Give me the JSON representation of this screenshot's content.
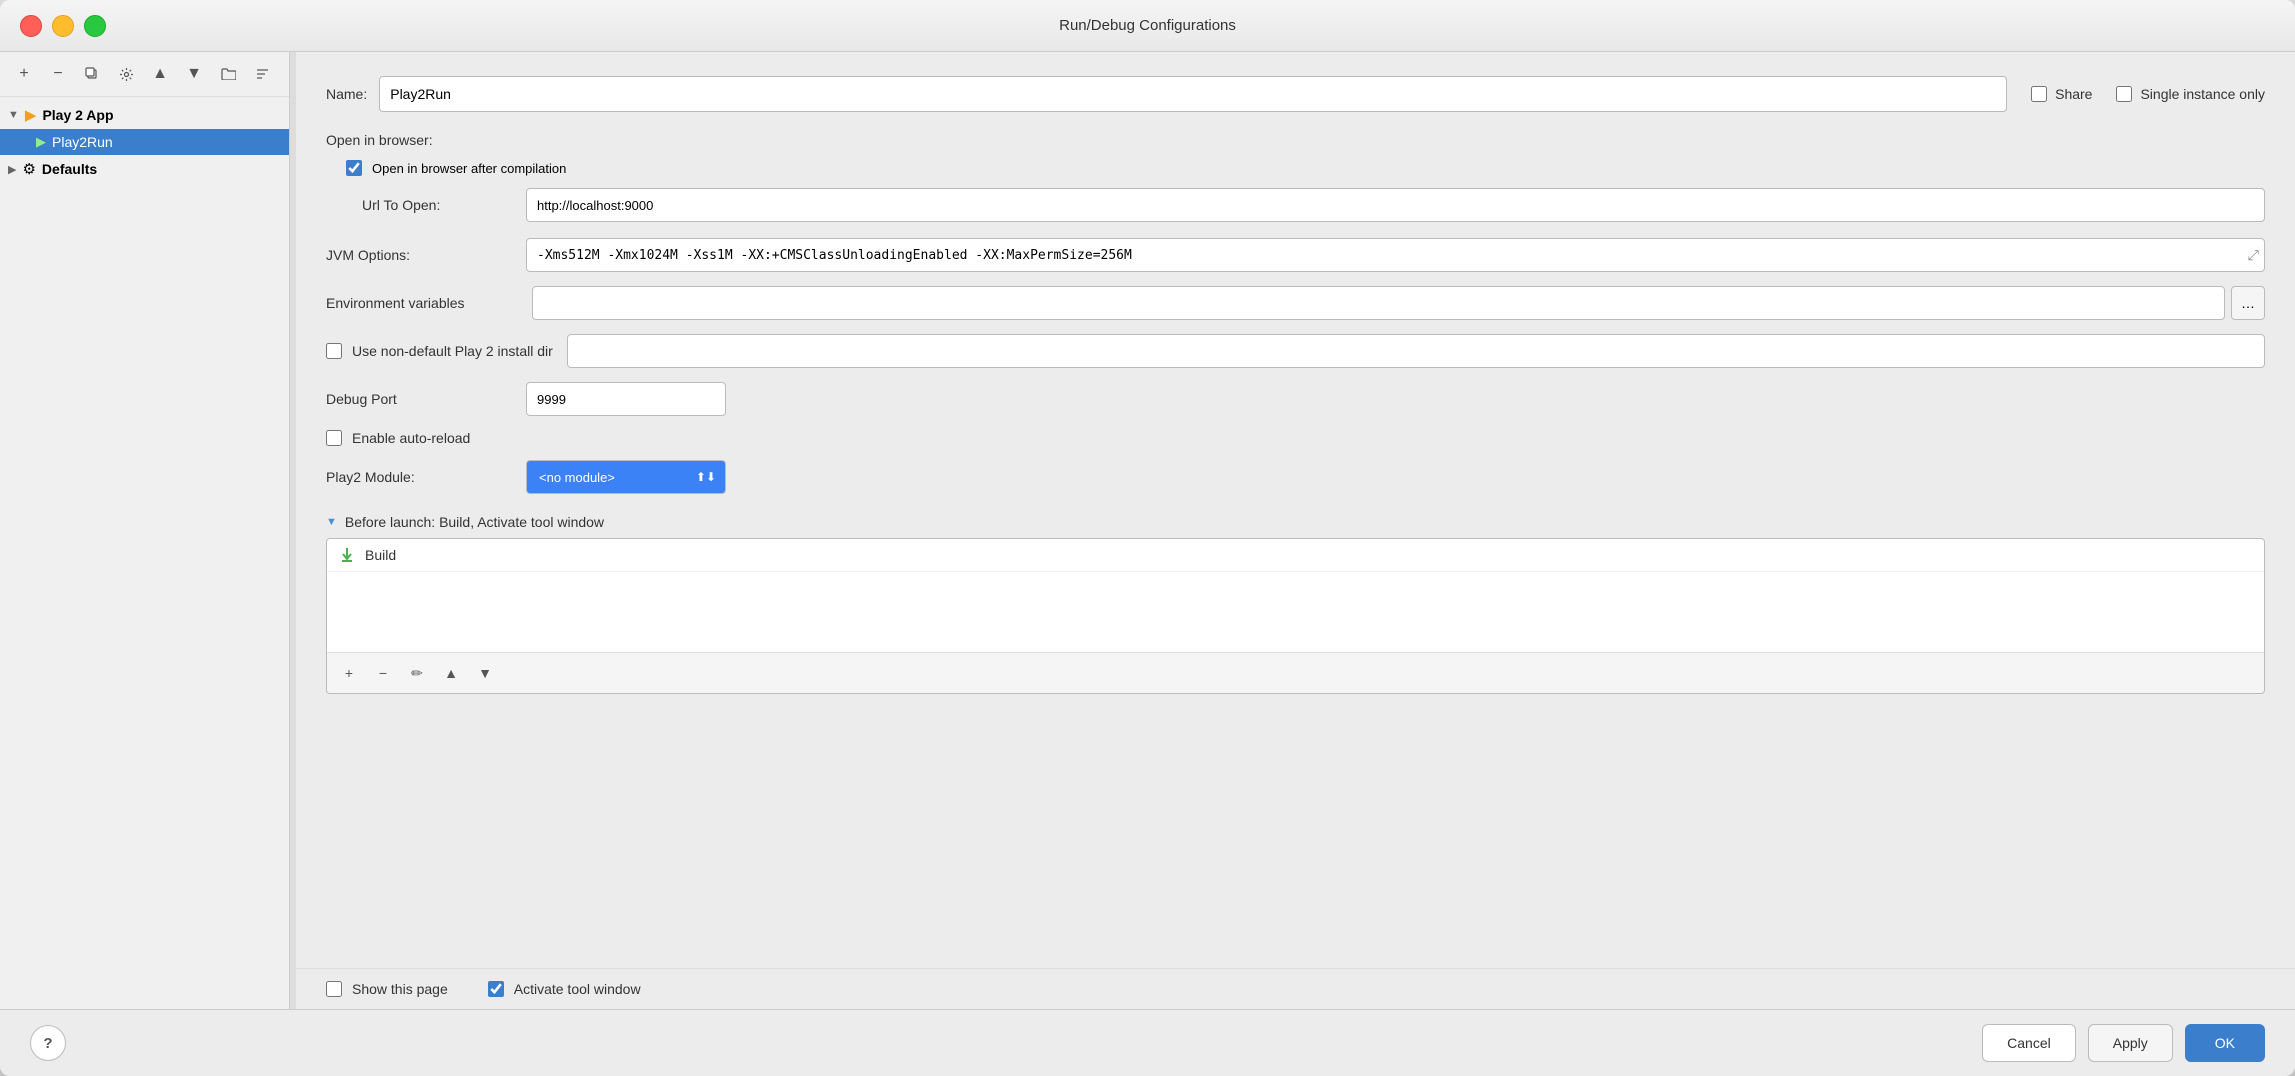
{
  "window": {
    "title": "Run/Debug Configurations"
  },
  "sidebar": {
    "toolbar": {
      "add_label": "+",
      "remove_label": "−",
      "copy_label": "⧉",
      "settings_label": "⚙",
      "up_label": "▲",
      "down_label": "▼",
      "folder_label": "📁",
      "sort_label": "⇅"
    },
    "tree": [
      {
        "id": "play2app",
        "level": 0,
        "label": "Play 2 App",
        "selected": false,
        "expanded": true
      },
      {
        "id": "play2run",
        "level": 1,
        "label": "Play2Run",
        "selected": true
      },
      {
        "id": "defaults",
        "level": 0,
        "label": "Defaults",
        "selected": false,
        "expanded": false
      }
    ]
  },
  "config": {
    "name_label": "Name:",
    "name_value": "Play2Run",
    "share_label": "Share",
    "single_instance_label": "Single instance only",
    "share_checked": false,
    "single_instance_checked": false,
    "open_in_browser_section": "Open in browser:",
    "open_in_browser_checked": true,
    "open_in_browser_label": "Open in browser after compilation",
    "url_label": "Url To Open:",
    "url_value": "http://localhost:9000",
    "jvm_label": "JVM Options:",
    "jvm_value": "-Xms512M -Xmx1024M -Xss1M -XX:+CMSClassUnloadingEnabled -XX:MaxPermSize=256M",
    "env_label": "Environment variables",
    "env_value": "",
    "use_non_default_label": "Use non-default Play 2 install dir",
    "use_non_default_checked": false,
    "use_non_default_dir_value": "",
    "debug_port_label": "Debug Port",
    "debug_port_value": "9999",
    "enable_autoreload_label": "Enable auto-reload",
    "enable_autoreload_checked": false,
    "play2_module_label": "Play2 Module:",
    "play2_module_value": "<no module>",
    "before_launch_title": "Before launch: Build, Activate tool window",
    "before_launch_items": [
      {
        "label": "Build"
      }
    ],
    "show_this_page_label": "Show this page",
    "show_this_page_checked": false,
    "activate_tool_window_label": "Activate tool window",
    "activate_tool_window_checked": true
  },
  "buttons": {
    "cancel_label": "Cancel",
    "apply_label": "Apply",
    "ok_label": "OK",
    "help_label": "?"
  }
}
